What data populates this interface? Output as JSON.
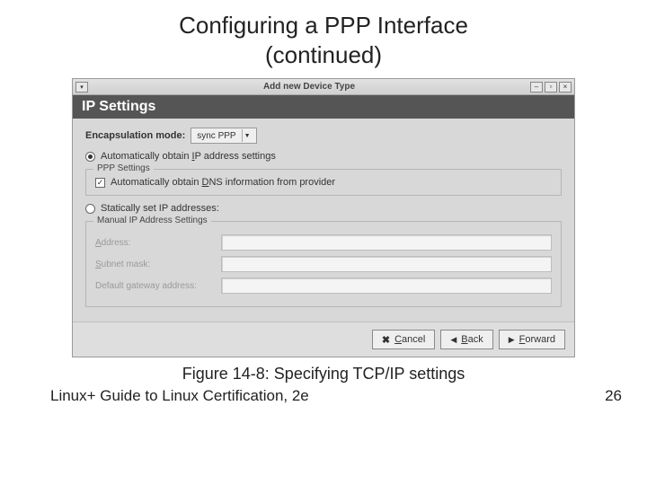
{
  "slide": {
    "title_line1": "Configuring a PPP Interface",
    "title_line2": "(continued)",
    "caption": "Figure 14-8: Specifying TCP/IP settings",
    "footer_left": "Linux+ Guide to Linux Certification, 2e",
    "footer_right": "26"
  },
  "window": {
    "title": "Add new Device Type",
    "header": "IP Settings",
    "encaps_label": "Encapsulation mode:",
    "encaps_value": "sync PPP",
    "radio_auto": "Automatically obtain IP address settings",
    "fieldset_ppp": "PPP Settings",
    "chk_dns": "Automatically obtain DNS information from provider",
    "radio_static": "Statically set IP addresses:",
    "fieldset_manual": "Manual IP Address Settings",
    "addr_label": "Address:",
    "mask_label": "Subnet mask:",
    "gw_label": "Default gateway address:",
    "buttons": {
      "cancel": "Cancel",
      "back": "Back",
      "forward": "Forward"
    }
  }
}
